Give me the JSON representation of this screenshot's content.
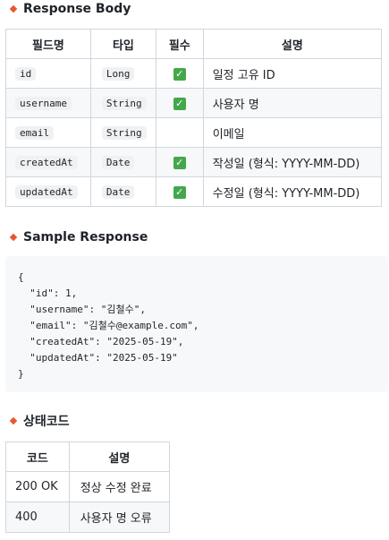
{
  "response_body": {
    "title": "Response Body",
    "headers": [
      "필드명",
      "타입",
      "필수",
      "설명"
    ],
    "rows": [
      {
        "field": "id",
        "type": "Long",
        "required": true,
        "desc": "일정 고유 ID"
      },
      {
        "field": "username",
        "type": "String",
        "required": true,
        "desc": "사용자 명"
      },
      {
        "field": "email",
        "type": "String",
        "required": false,
        "desc": "이메일"
      },
      {
        "field": "createdAt",
        "type": "Date",
        "required": true,
        "desc": "작성일 (형식: YYYY-MM-DD)"
      },
      {
        "field": "updatedAt",
        "type": "Date",
        "required": true,
        "desc": "수정일 (형식: YYYY-MM-DD)"
      }
    ],
    "check_glyph": "✓"
  },
  "sample_response": {
    "title": "Sample Response",
    "lines": [
      "{",
      "  \"id\": 1,",
      "  \"username\": \"김철수\",",
      "  \"email\": \"김철수@example.com\",",
      "  \"createdAt\": \"2025-05-19\",",
      "  \"updatedAt\": \"2025-05-19\"",
      "}"
    ]
  },
  "status_codes": {
    "title": "상태코드",
    "headers": [
      "코드",
      "설명"
    ],
    "rows": [
      {
        "code": "200 OK",
        "desc": "정상 수정 완료"
      },
      {
        "code": "400",
        "desc": "사용자 명 오류"
      }
    ]
  }
}
